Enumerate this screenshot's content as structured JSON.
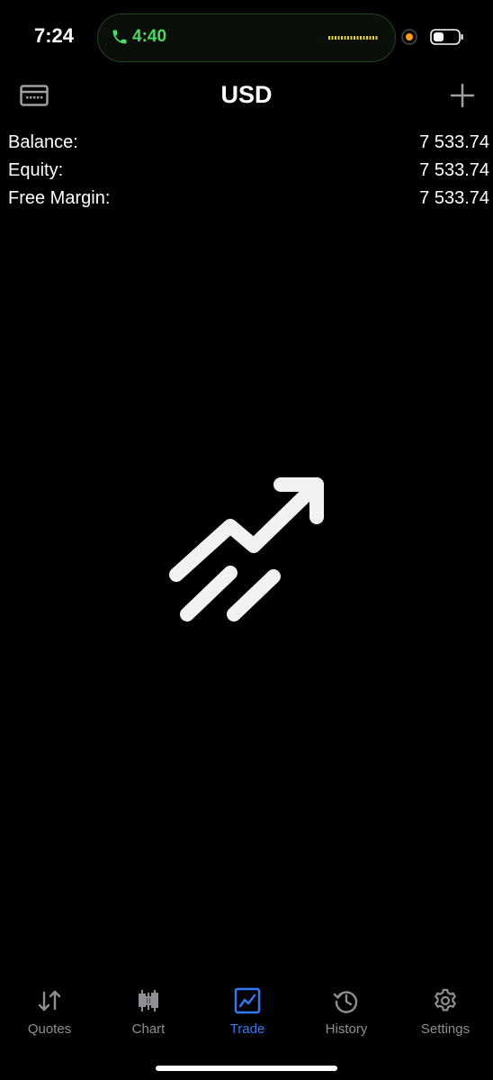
{
  "status_bar": {
    "time": "7:24",
    "call_timer": "4:40"
  },
  "header": {
    "title": "USD"
  },
  "summary": [
    {
      "label": "Balance:",
      "value": "7 533.74"
    },
    {
      "label": "Equity:",
      "value": "7 533.74"
    },
    {
      "label": "Free Margin:",
      "value": "7 533.74"
    }
  ],
  "tabs": [
    {
      "label": "Quotes",
      "icon": "quotes-arrows-icon",
      "active": false
    },
    {
      "label": "Chart",
      "icon": "candlestick-icon",
      "active": false
    },
    {
      "label": "Trade",
      "icon": "trade-chart-icon",
      "active": true
    },
    {
      "label": "History",
      "icon": "history-clock-icon",
      "active": false
    },
    {
      "label": "Settings",
      "icon": "gear-icon",
      "active": false
    }
  ],
  "colors": {
    "background": "#000000",
    "text": "#ffffff",
    "accent": "#3478f6",
    "inactive_tab": "#8e8e93",
    "call_green": "#4cd964",
    "mic_orange": "#ff9f0a"
  }
}
